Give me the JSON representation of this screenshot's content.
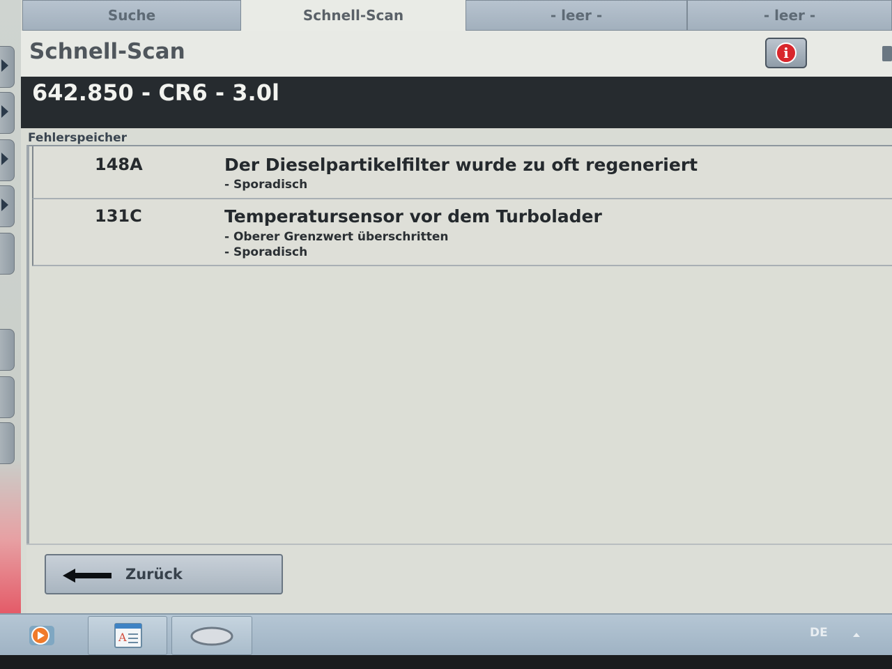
{
  "tabs": [
    {
      "label": "Suche",
      "active": false
    },
    {
      "label": "Schnell-Scan",
      "active": true
    },
    {
      "label": "- leer -",
      "active": false
    },
    {
      "label": "- leer -",
      "active": false
    }
  ],
  "header": {
    "title": "Schnell-Scan",
    "info_icon": "info-icon"
  },
  "vehicle": {
    "id": "642.850 - CR6 - 3.0l"
  },
  "fault_memory": {
    "label": "Fehlerspeicher",
    "faults": [
      {
        "code": "148A",
        "text": "Der Dieselpartikelfilter wurde zu oft regeneriert",
        "details": [
          "- Sporadisch"
        ]
      },
      {
        "code": "131C",
        "text": "Temperatursensor vor dem Turbolader",
        "details": [
          "- Oberer Grenzwert überschritten",
          "- Sporadisch"
        ]
      }
    ]
  },
  "footer": {
    "back_label": "Zurück"
  },
  "taskbar": {
    "language": "DE"
  },
  "colors": {
    "info_red": "#d8262c",
    "vehicle_bar": "#262b2f"
  }
}
